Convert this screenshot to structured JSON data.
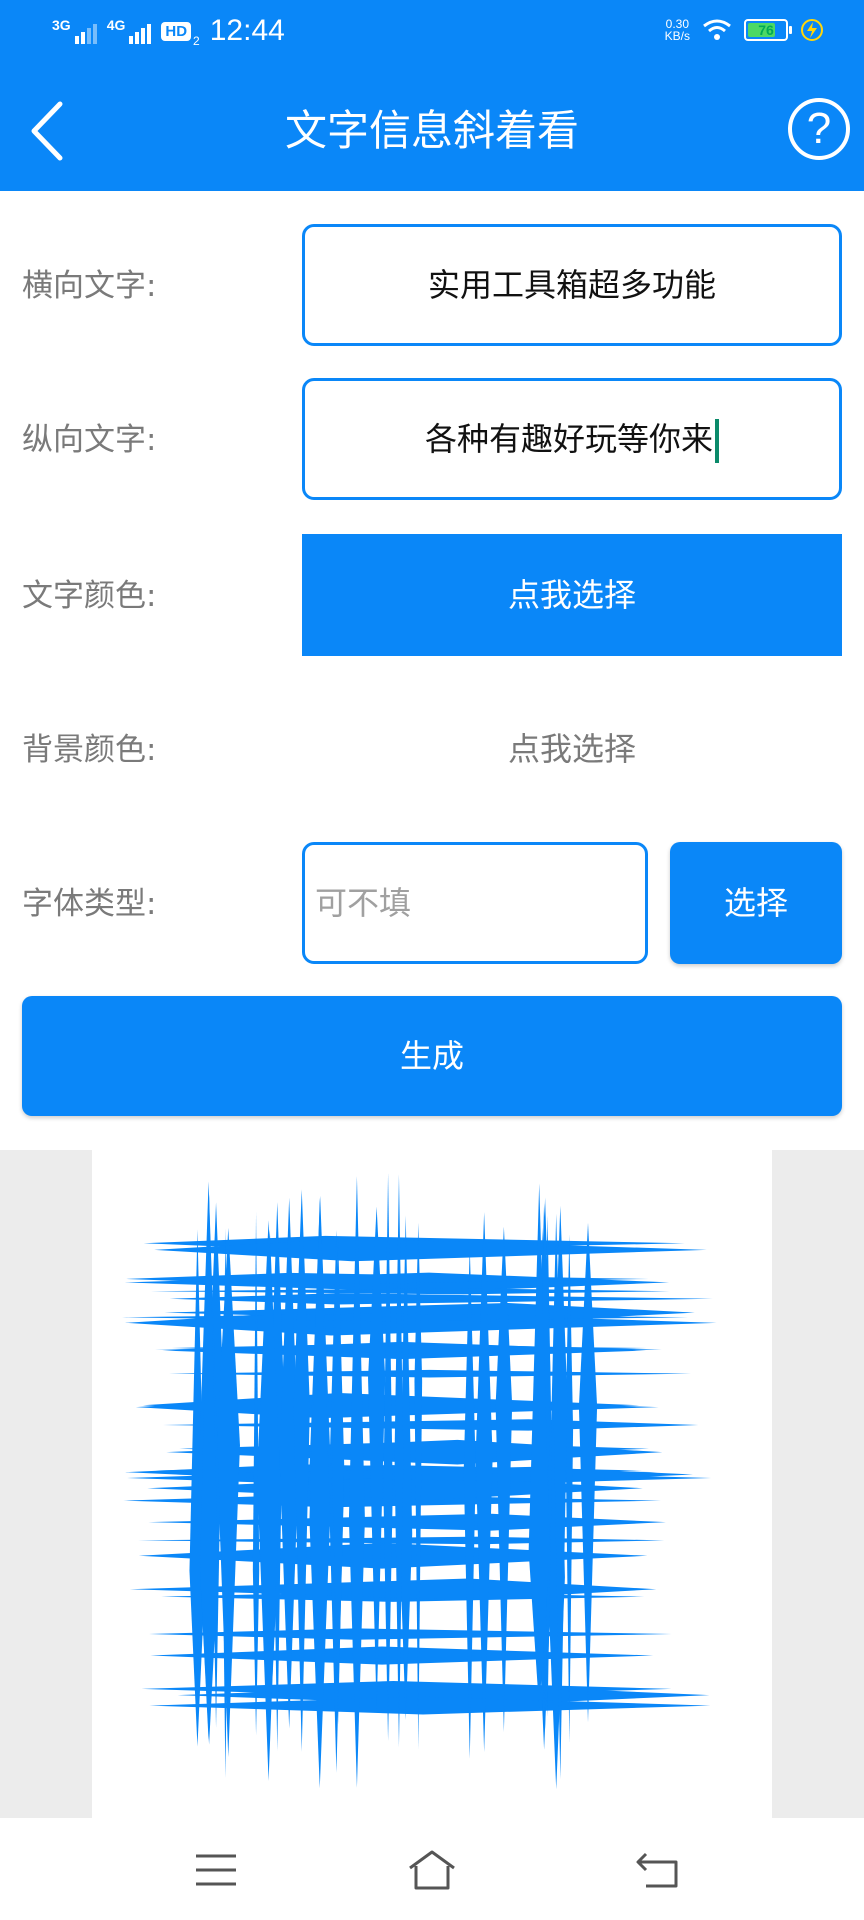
{
  "status_bar": {
    "signal1": "3G",
    "signal2": "4G",
    "hd": "HD",
    "hd_sub": "2",
    "time": "12:44",
    "net_speed_value": "0.30",
    "net_speed_unit": "KB/s",
    "battery_percent": 76
  },
  "header": {
    "title": "文字信息斜着看",
    "back_icon": "chevron-left-icon",
    "help_icon": "question-circle-icon",
    "help_glyph": "?"
  },
  "form": {
    "horizontal_label": "横向文字:",
    "horizontal_value": "实用工具箱超多功能",
    "vertical_label": "纵向文字:",
    "vertical_value": "各种有趣好玩等你来",
    "text_color_label": "文字颜色:",
    "text_color_button": "点我选择",
    "bg_color_label": "背景颜色:",
    "bg_color_button": "点我选择",
    "font_label": "字体类型:",
    "font_placeholder": "可不填",
    "font_select_button": "选择",
    "generate_button": "生成"
  },
  "preview": {
    "stroke_color": "#0a87f8",
    "background": "#ffffff"
  },
  "nav_bar": {
    "menu_icon": "menu-icon",
    "home_icon": "home-icon",
    "back_icon": "back-icon"
  },
  "colors": {
    "accent": "#0a87f8",
    "label_gray": "#7a7a7a"
  }
}
